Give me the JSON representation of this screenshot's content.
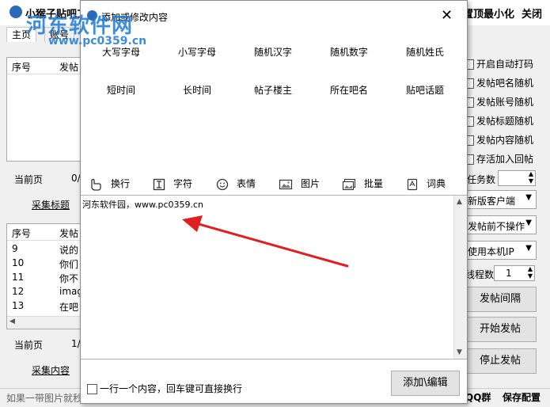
{
  "main": {
    "title": "小猴子贴吧工",
    "top_buttons": [
      "置顶",
      "最小化",
      "关闭"
    ],
    "tabs": [
      "主页",
      "账号"
    ],
    "upper_list": {
      "headers": [
        "序号",
        "发帖"
      ],
      "rows": []
    },
    "upper_pager": {
      "label": "当前页",
      "value": "0/"
    },
    "collect_title_link": "采集标题",
    "lower_list": {
      "headers": [
        "序号",
        "发帖"
      ],
      "rows": [
        [
          "9",
          "说的"
        ],
        [
          "10",
          "你们"
        ],
        [
          "11",
          "你不"
        ],
        [
          "12",
          "imag"
        ],
        [
          "13",
          "在吧"
        ]
      ]
    },
    "lower_pager": {
      "label": "当前页",
      "value": "1/"
    },
    "collect_content_link": "采集内容",
    "status_text": "如果一带图片就秒",
    "checkboxes": [
      "开启自动打码",
      "发帖吧名随机",
      "发帖账号随机",
      "发帖标题随机",
      "发帖内容随机",
      "存活加入回帖"
    ],
    "task_count": {
      "label": "任务数",
      "value": ""
    },
    "combos": [
      "新版客户端",
      "发帖前不操作",
      "使用本机IP"
    ],
    "thread_count": {
      "label": "线程数",
      "value": "1"
    },
    "buttons": [
      "发帖间隔",
      "开始发帖",
      "停止发帖"
    ],
    "bottom_links": [
      "QQ群",
      "保存配置"
    ]
  },
  "dialog": {
    "title": "添加或修改内容",
    "placeholders_row1": [
      "大写字母",
      "小写字母",
      "随机汉字",
      "随机数字",
      "随机姓氏"
    ],
    "placeholders_row2": [
      "短时间",
      "长时间",
      "帖子楼主",
      "所在吧名",
      "贴吧话题"
    ],
    "toolbar": [
      {
        "icon": "hand-pointer-icon",
        "label": "换行"
      },
      {
        "icon": "text-cursor-icon",
        "label": "字符"
      },
      {
        "icon": "smiley-icon",
        "label": "表情"
      },
      {
        "icon": "image-icon",
        "label": "图片"
      },
      {
        "icon": "images-batch-icon",
        "label": "批量"
      },
      {
        "icon": "dictionary-icon",
        "label": "词典"
      }
    ],
    "editor_text": "河东软件园，www.pc0359.cn",
    "footer_checkbox": "一行一个内容，回车键可直接换行",
    "submit_button": "添加\\编辑"
  },
  "watermark": {
    "name": "河东软件网",
    "url": "www.pc0359.cn"
  },
  "colors": {
    "accent_blue": "#2a6bb8",
    "arrow_red": "#e02020",
    "watermark_blue": "#1c7ad4"
  }
}
